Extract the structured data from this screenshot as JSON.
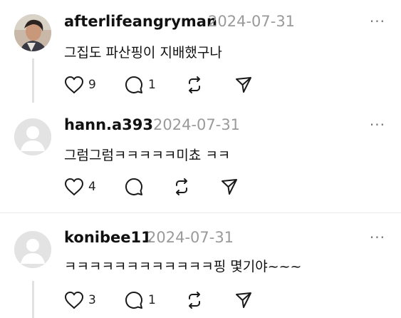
{
  "posts": [
    {
      "username": "afterlifeangryman",
      "date": "2024-07-31",
      "more_label": "···",
      "text": "그집도 파산핑이 지배했구나",
      "likes": "9",
      "replies": "1",
      "avatar": "photo-avatar"
    },
    {
      "username": "hann.a393",
      "date": "2024-07-31",
      "more_label": "···",
      "text": "그럼그럼ㅋㅋㅋㅋㅋ미쵸 ㅋㅋ",
      "likes": "4",
      "replies": "",
      "avatar": "default-avatar"
    },
    {
      "username": "konibee11",
      "date": "2024-07-31",
      "more_label": "···",
      "text": "ㅋㅋㅋㅋㅋㅋㅋㅋㅋㅋㅋㅋ핑 몇기야~~~",
      "likes": "3",
      "replies": "1",
      "avatar": "default-avatar"
    }
  ],
  "icons": {
    "like": "heart-icon",
    "reply": "comment-icon",
    "repost": "repost-icon",
    "share": "send-icon"
  },
  "colors": {
    "username": "#111111",
    "date": "#9a9a9a",
    "divider": "#e9e9e9",
    "thread_line": "#e2e2e2"
  }
}
